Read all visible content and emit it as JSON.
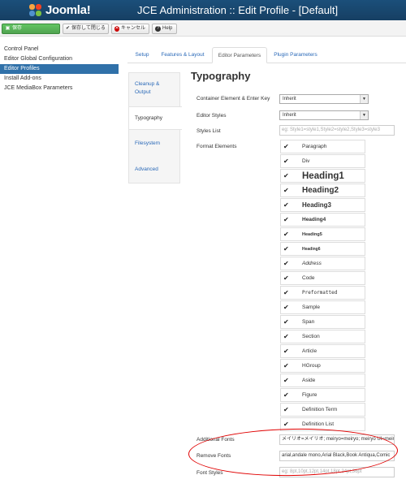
{
  "header": {
    "logo_text": "Joomla!",
    "title": "JCE Administration :: Edit Profile - [Default]",
    "bg_color": "#1b4f7a"
  },
  "toolbar": {
    "save_label": "保存",
    "save_close_label": "保存して閉じる",
    "cancel_label": "キャンセル",
    "help_label": "Help"
  },
  "sidebar": {
    "items": [
      {
        "label": "Control Panel"
      },
      {
        "label": "Editor Global Configuration"
      },
      {
        "label": "Editor Profiles"
      },
      {
        "label": "Install Add-ons"
      },
      {
        "label": "JCE MediaBox Parameters"
      }
    ]
  },
  "tabs": [
    {
      "label": "Setup"
    },
    {
      "label": "Features & Layout"
    },
    {
      "label": "Editor Parameters"
    },
    {
      "label": "Plugin Parameters"
    }
  ],
  "vtabs": [
    {
      "label": "Cleanup &"
    },
    {
      "label": "Output"
    },
    {
      "label": "Typography"
    },
    {
      "label": "Filesystem"
    },
    {
      "label": "Advanced"
    }
  ],
  "section": {
    "title": "Typography"
  },
  "fields": {
    "container": {
      "label": "Container Element & Enter Key",
      "value": "Inherit"
    },
    "editor_styles": {
      "label": "Editor Styles",
      "value": "Inherit"
    },
    "styles_list": {
      "label": "Styles List",
      "placeholder": "eg: Style1=style1,Style2=style2,Style3=style3"
    },
    "format_elements": {
      "label": "Format Elements"
    },
    "additional_fonts": {
      "label": "Additional Fonts",
      "value": "メイリオ=メイリオ; meiryo=meiryo; meiryo UI=meiryo"
    },
    "remove_fonts": {
      "label": "Remove Fonts",
      "value": "arial,andale mono,Arial Black,Book Antiqua,Comic"
    },
    "font_styles": {
      "label": "Font Styles",
      "placeholder": "eg: 8pt,10pt,12pt,14pt,18pt,24pt,36pt"
    }
  },
  "format_elements": [
    {
      "label": "Paragraph"
    },
    {
      "label": "Div"
    },
    {
      "label": "Heading1"
    },
    {
      "label": "Heading2"
    },
    {
      "label": "Heading3"
    },
    {
      "label": "Heading4"
    },
    {
      "label": "Heading5"
    },
    {
      "label": "Heading6"
    },
    {
      "label": "Address"
    },
    {
      "label": "Code"
    },
    {
      "label": "Preformatted"
    },
    {
      "label": "Sample"
    },
    {
      "label": "Span"
    },
    {
      "label": "Section"
    },
    {
      "label": "Article"
    },
    {
      "label": "HGroup"
    },
    {
      "label": "Aside"
    },
    {
      "label": "Figure"
    },
    {
      "label": "Definition Term"
    },
    {
      "label": "Definition List"
    }
  ],
  "checkmark": "✔",
  "annotation_color": "#e00000"
}
